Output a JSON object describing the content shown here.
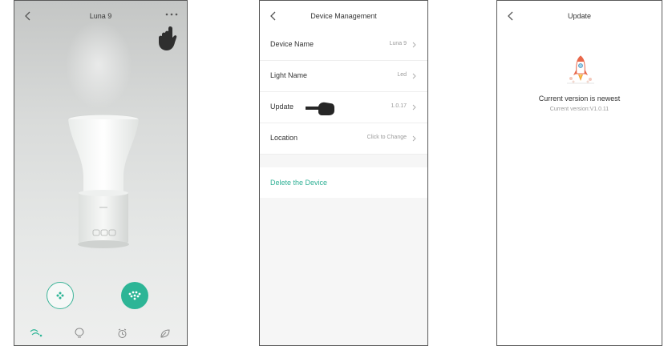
{
  "screen1": {
    "title": "Luna 9",
    "icons": {
      "back": "chevron-left-icon",
      "more": "more-dots-icon",
      "pointer": "hand-pointer-icon",
      "mist_mode": "mist-mode-icon",
      "mist_on": "mist-power-icon",
      "nav_mist": "mist-wave-icon",
      "nav_light": "lightbulb-icon",
      "nav_timer": "alarm-clock-icon",
      "nav_scene": "leaf-icon"
    },
    "colors": {
      "accent": "#2db596"
    }
  },
  "screen2": {
    "title": "Device Management",
    "rows": [
      {
        "label": "Device Name",
        "value": "Luna 9"
      },
      {
        "label": "Light Name",
        "value": "Led"
      },
      {
        "label": "Update",
        "value": "1.0.17"
      },
      {
        "label": "Location",
        "value": "Click to Change"
      }
    ],
    "delete_label": "Delete the Device",
    "colors": {
      "delete": "#2fb095"
    }
  },
  "screen3": {
    "title": "Update",
    "status": "Current version is newest",
    "version_text": "Current version:V1.0.11"
  }
}
